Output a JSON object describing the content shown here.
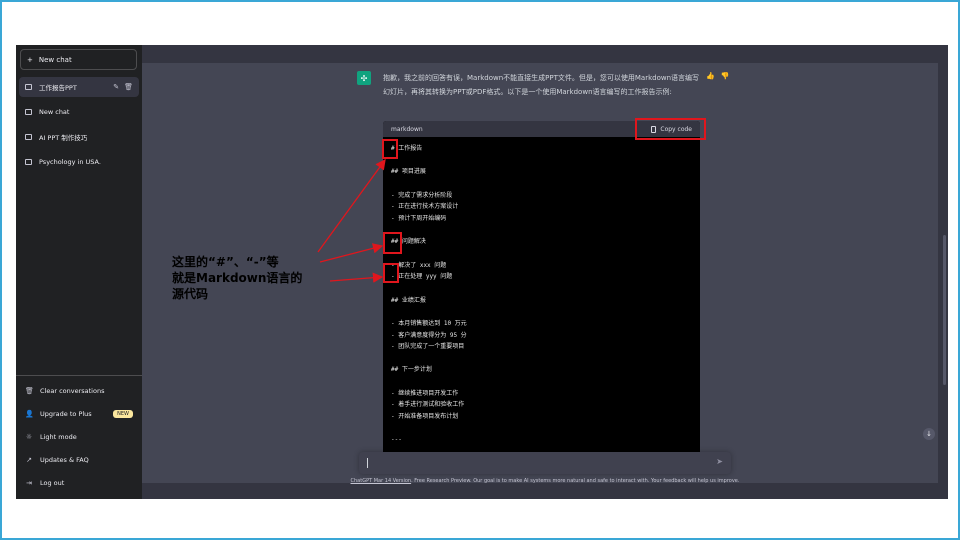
{
  "sidebar": {
    "new_chat": "New chat",
    "conversations": [
      {
        "label": "工作报告PPT",
        "active": true
      },
      {
        "label": "New chat",
        "active": false
      },
      {
        "label": "AI PPT 制作技巧",
        "active": false
      },
      {
        "label": "Psychology in USA.",
        "active": false
      }
    ],
    "bottom": {
      "clear": "Clear conversations",
      "upgrade": "Upgrade to Plus",
      "new_badge": "NEW",
      "light_mode": "Light mode",
      "updates": "Updates & FAQ",
      "logout": "Log out"
    }
  },
  "message": {
    "text": "抱歉，我之前的回答有误，Markdown不能直接生成PPT文件。但是，您可以使用Markdown语言编写幻灯片，再将其转换为PPT或PDF格式。以下是一个使用Markdown语言编写的工作报告示例:"
  },
  "code": {
    "language": "markdown",
    "copy_label": "Copy code",
    "lines": [
      "# 工作报告",
      "",
      "## 项目进展",
      "",
      "- 完成了需求分析阶段",
      "- 正在进行技术方案设计",
      "- 预计下周开始编码",
      "",
      "## 问题解决",
      "",
      "- 解决了 xxx 问题",
      "- 正在处理 yyy 问题",
      "",
      "## 业绩汇报",
      "",
      "- 本月销售额达到 10 万元",
      "- 客户满意度得分为 95 分",
      "- 团队完成了一个重要项目",
      "",
      "## 下一步计划",
      "",
      "- 继续推进项目开发工作",
      "- 着手进行测试和验收工作",
      "- 开始准备项目发布计划",
      "",
      "---"
    ]
  },
  "footer": {
    "version": "ChatGPT Mar 14 Version",
    "text": ". Free Research Preview. Our goal is to make AI systems more natural and safe to interact with. Your feedback will help us improve."
  },
  "annotation": {
    "line1": "这里的“#”、“-”等",
    "line2": "就是Markdown语言的",
    "line3": "源代码"
  },
  "colors": {
    "highlight": "#e0161d",
    "accent": "#10a37f",
    "slide_border": "#3aa7d6"
  }
}
